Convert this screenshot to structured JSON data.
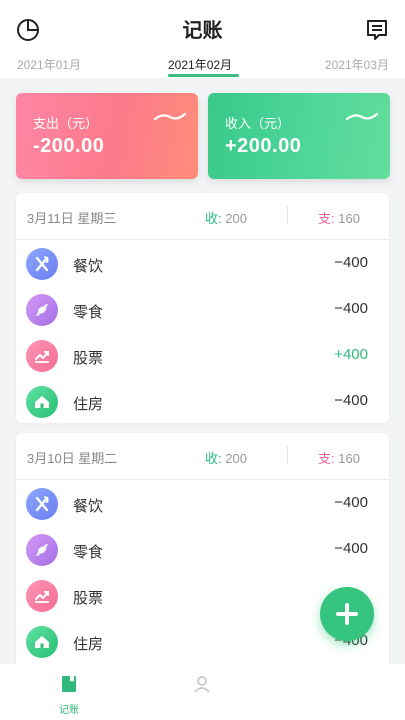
{
  "header": {
    "title": "记账",
    "left_icon": "pie-chart-icon",
    "right_icon": "list-document-icon"
  },
  "tabs": [
    {
      "label": "2021年01月"
    },
    {
      "label": "2021年02月"
    },
    {
      "label": "2021年03月"
    }
  ],
  "summary": {
    "expense_label": "支出（元）",
    "expense_value": "-200.00",
    "income_label": "收入（元）",
    "income_value": "+200.00"
  },
  "days": [
    {
      "date": "3月11日  星期三",
      "income_key": "收:",
      "income_value": "200",
      "expense_key": "支:",
      "expense_value": "160",
      "items": [
        {
          "label": "餐饮",
          "amount": "−400",
          "icon": "utensils-icon"
        },
        {
          "label": "零食",
          "amount": "−400",
          "icon": "candy-icon"
        },
        {
          "label": "股票",
          "amount": "+400",
          "icon": "stock-chart-icon"
        },
        {
          "label": "住房",
          "amount": "−400",
          "icon": "house-icon"
        }
      ]
    },
    {
      "date": "3月10日  星期二",
      "income_key": "收:",
      "income_value": "200",
      "expense_key": "支:",
      "expense_value": "160",
      "items": [
        {
          "label": "餐饮",
          "amount": "−400",
          "icon": "utensils-icon"
        },
        {
          "label": "零食",
          "amount": "−400",
          "icon": "candy-icon"
        },
        {
          "label": "股票",
          "amount": "",
          "icon": "stock-chart-icon"
        },
        {
          "label": "住房",
          "amount": "−400",
          "icon": "house-icon"
        }
      ]
    }
  ],
  "fab": {
    "icon": "plus-icon"
  },
  "bottom_nav": [
    {
      "label": "记账",
      "icon": "bookkeeping-icon"
    },
    {
      "label": "",
      "icon": "profile-icon"
    }
  ],
  "colors": {
    "accent": "#34c47f",
    "expense": "#fd7a8b",
    "income_text": "#2fba7c",
    "expense_text": "#f0679a"
  }
}
